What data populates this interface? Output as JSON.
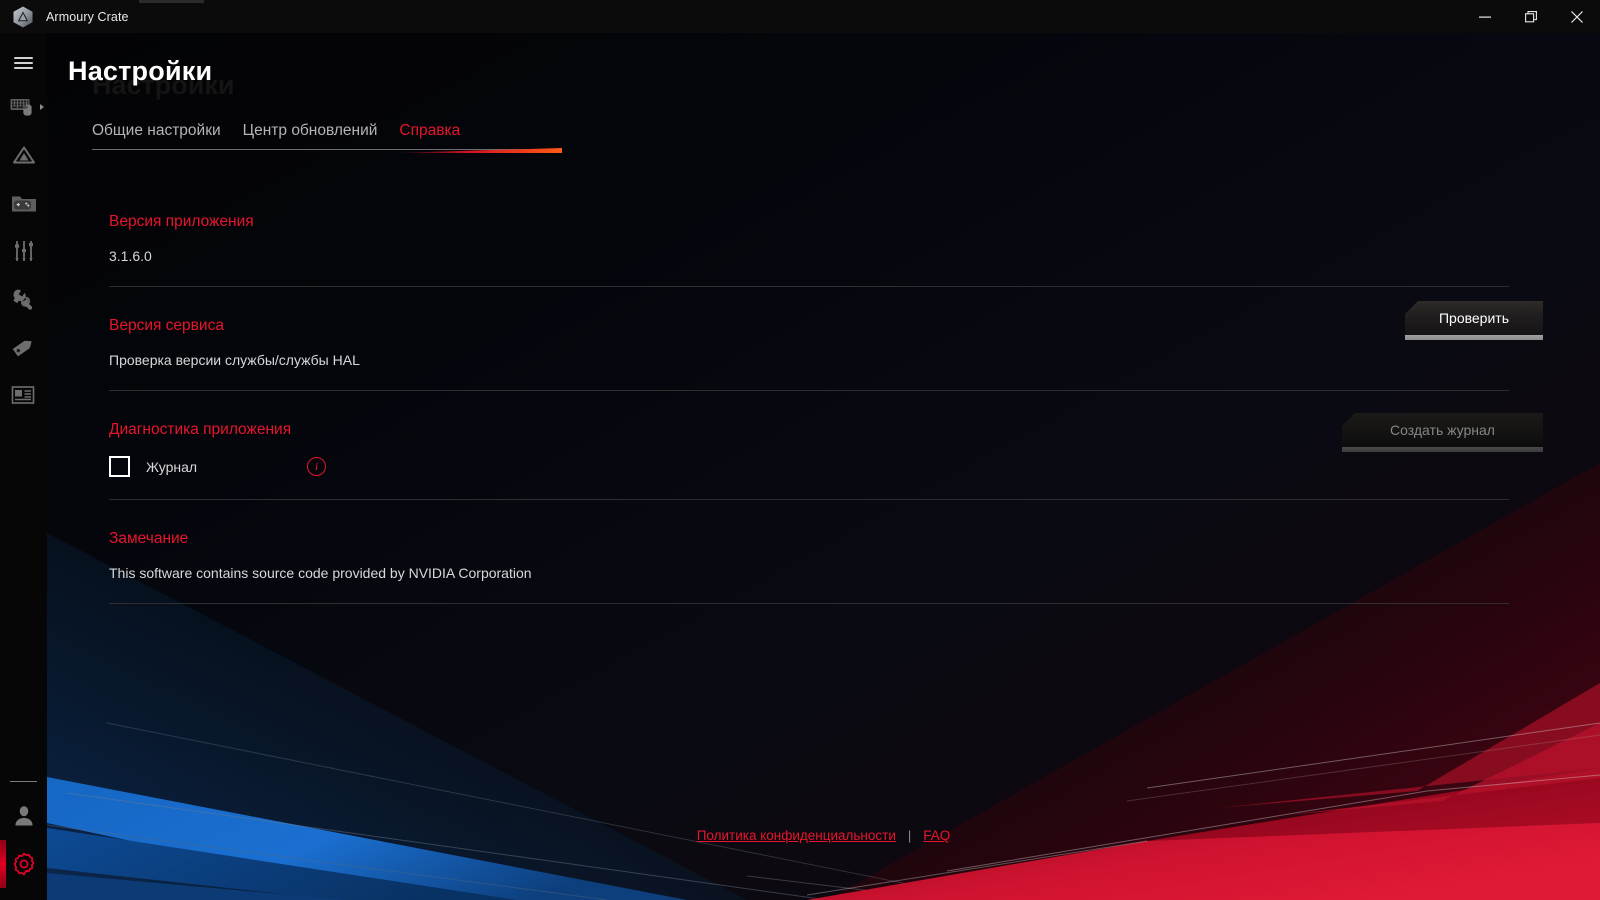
{
  "window": {
    "title": "Armoury Crate",
    "logo_icon": "armoury-crate-logo-icon",
    "minimize_icon": "minimize-icon",
    "maximize_icon": "restore-icon",
    "close_icon": "close-icon"
  },
  "sidebar": {
    "menu_icon": "hamburger-menu-icon",
    "items": [
      {
        "name": "device-keyboard-mouse",
        "icon": "keyboard-mouse-icon",
        "has_arrow": true
      },
      {
        "name": "aura-sync",
        "icon": "aura-triangle-icon",
        "has_arrow": false
      },
      {
        "name": "game-library",
        "icon": "game-folder-icon",
        "has_arrow": false
      },
      {
        "name": "scenario-profiles",
        "icon": "sliders-icon",
        "has_arrow": false
      },
      {
        "name": "tools",
        "icon": "wrench-icon",
        "has_arrow": false
      },
      {
        "name": "deals",
        "icon": "tag-icon",
        "has_arrow": false
      },
      {
        "name": "news",
        "icon": "news-panel-icon",
        "has_arrow": false
      }
    ],
    "bottom_items": [
      {
        "name": "user-account",
        "icon": "person-icon",
        "active": false
      },
      {
        "name": "settings",
        "icon": "gear-icon",
        "active": true
      }
    ]
  },
  "header": {
    "title": "Настройки",
    "ghost_title": "Настройки"
  },
  "tabs": [
    {
      "label": "Общие настройки",
      "active": false,
      "name": "tab-general-settings"
    },
    {
      "label": "Центр обновлений",
      "active": false,
      "name": "tab-update-center"
    },
    {
      "label": "Справка",
      "active": true,
      "name": "tab-help"
    }
  ],
  "sections": {
    "app_version": {
      "heading": "Версия приложения",
      "value": "3.1.6.0"
    },
    "service_version": {
      "heading": "Версия сервиса",
      "value": "Проверка версии службы/службы HAL",
      "button_label": "Проверить"
    },
    "diagnostics": {
      "heading": "Диагностика приложения",
      "checkbox_label": "Журнал",
      "checkbox_checked": false,
      "info_icon": "info-circle-icon",
      "info_glyph": "i",
      "button_label": "Создать журнал",
      "button_disabled": true
    },
    "notice": {
      "heading": "Замечание",
      "value": "This software contains source code provided by NVIDIA Corporation"
    }
  },
  "footer": {
    "privacy_label": "Политика конфиденциальности",
    "separator": "|",
    "faq_label": "FAQ"
  },
  "colors": {
    "accent_red": "#e8152c",
    "accent_orange": "#ff5a16",
    "background": "#000000",
    "text_primary": "#ffffff",
    "text_secondary": "#d8d8d8",
    "text_muted": "#b4b4b4",
    "blue_band": "#1565c0",
    "red_band": "#c8102e"
  }
}
